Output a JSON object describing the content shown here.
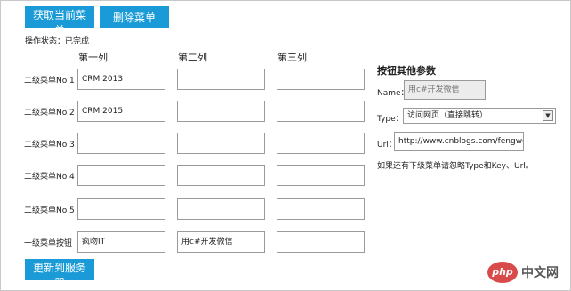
{
  "toolbar": {
    "get_menu_label": "获取当前菜单",
    "delete_menu_label": "删除菜单",
    "update_label": "更新到服务器"
  },
  "status": {
    "text": "操作状态：已完成"
  },
  "columns": [
    "第一列",
    "第二列",
    "第三列"
  ],
  "rows": [
    {
      "label": "二级菜单No.1",
      "values": [
        "CRM 2013",
        "",
        ""
      ]
    },
    {
      "label": "二级菜单No.2",
      "values": [
        "CRM 2015",
        "",
        ""
      ]
    },
    {
      "label": "二级菜单No.3",
      "values": [
        "",
        "",
        ""
      ]
    },
    {
      "label": "二级菜单No.4",
      "values": [
        "",
        "",
        ""
      ]
    },
    {
      "label": "二级菜单No.5",
      "values": [
        "",
        "",
        ""
      ]
    },
    {
      "label": "一级菜单按钮",
      "values": [
        "疯吻IT",
        "用c#开发微信",
        ""
      ]
    }
  ],
  "params": {
    "title": "按钮其他参数",
    "name_label": "Name：",
    "name_value": "用c#开发微信",
    "type_label": "Type：",
    "type_value": "访问网页（直接跳转）",
    "url_label": "Url：",
    "url_value": "http://www.cnblogs.com/fengwenit",
    "note": "如果还有下级菜单请忽略Type和Key、Url。"
  },
  "watermark": {
    "logo": "php",
    "text": "中文网"
  },
  "colors": {
    "accent": "#1a9bd7",
    "border": "#9a9a9a"
  }
}
